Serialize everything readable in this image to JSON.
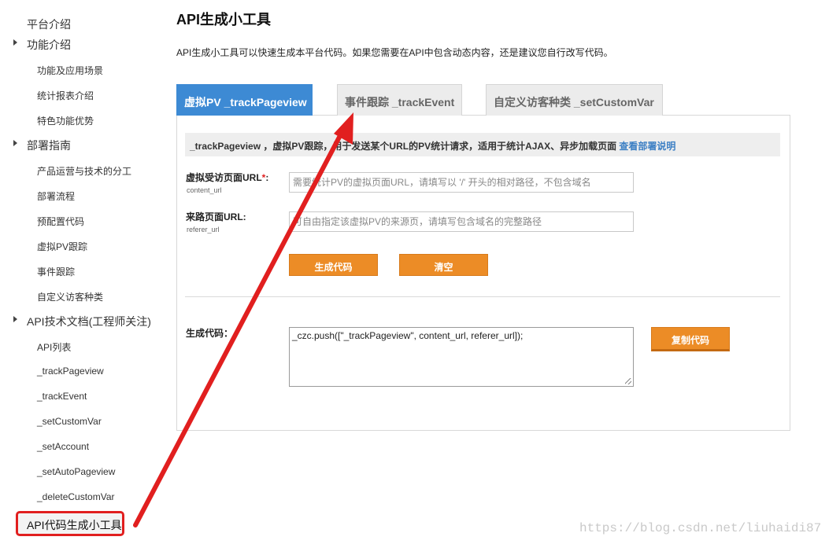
{
  "sidebar": {
    "items": [
      {
        "label": "平台介绍",
        "level": 1,
        "expandable": false
      },
      {
        "label": "功能介绍",
        "level": 1,
        "expandable": true
      },
      {
        "label": "功能及应用场景",
        "level": 2
      },
      {
        "label": "统计报表介绍",
        "level": 2
      },
      {
        "label": "特色功能优势",
        "level": 2
      },
      {
        "label": "部署指南",
        "level": 1,
        "expandable": true
      },
      {
        "label": "产品运营与技术的分工",
        "level": 2
      },
      {
        "label": "部署流程",
        "level": 2
      },
      {
        "label": "预配置代码",
        "level": 2
      },
      {
        "label": "虚拟PV跟踪",
        "level": 2
      },
      {
        "label": "事件跟踪",
        "level": 2
      },
      {
        "label": "自定义访客种类",
        "level": 2
      },
      {
        "label": "API技术文档(工程师关注)",
        "level": 1,
        "expandable": true
      },
      {
        "label": "API列表",
        "level": 2
      },
      {
        "label": "_trackPageview",
        "level": 2
      },
      {
        "label": "_trackEvent",
        "level": 2
      },
      {
        "label": "_setCustomVar",
        "level": 2
      },
      {
        "label": "_setAccount",
        "level": 2
      },
      {
        "label": "_setAutoPageview",
        "level": 2
      },
      {
        "label": "_deleteCustomVar",
        "level": 2
      },
      {
        "label": "API代码生成小工具",
        "level": 1,
        "highlighted": true
      }
    ]
  },
  "main": {
    "title": "API生成小工具",
    "description": "API生成小工具可以快速生成本平台代码。如果您需要在API中包含动态内容，还是建议您自行改写代码。",
    "tabs": [
      {
        "label": "虚拟PV _trackPageview",
        "active": true
      },
      {
        "label": "事件跟踪 _trackEvent",
        "active": false
      },
      {
        "label": "自定义访客种类 _setCustomVar",
        "active": false
      }
    ],
    "info": {
      "text": "_trackPageview ，虚拟PV跟踪，用于发送某个URL的PV统计请求，适用于统计AJAX、异步加载页面 ",
      "link": "查看部署说明"
    },
    "form": {
      "content_url": {
        "label": "虚拟受访页面URL",
        "required_mark": "*",
        "colon": ":",
        "sub": "content_url",
        "placeholder": "需要统计PV的虚拟页面URL，请填写以 '/' 开头的相对路径，不包含域名"
      },
      "referer_url": {
        "label": "来路页面URL:",
        "sub": "referer_url",
        "placeholder": "可自由指定该虚拟PV的来源页，请填写包含域名的完整路径"
      },
      "generate_label": "生成代码",
      "clear_label": "清空"
    },
    "output": {
      "label": "生成代码：",
      "code": "_czc.push([\"_trackPageview\", content_url, referer_url]);",
      "copy_label": "复制代码"
    }
  },
  "annotation": {
    "color": "#e11f1f"
  },
  "watermark": "https://blog.csdn.net/liuhaidi87",
  "colors": {
    "tab_active": "#3d8ad4",
    "button": "#ec8c26",
    "link": "#3c7fc4",
    "highlight_border": "#e11f1f"
  }
}
